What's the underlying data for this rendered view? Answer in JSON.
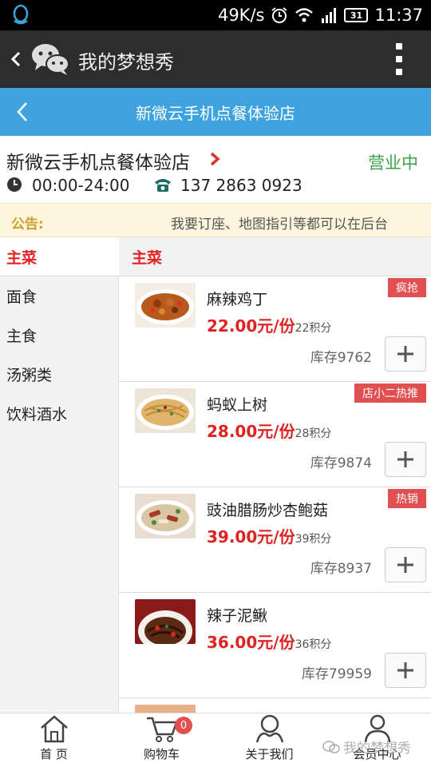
{
  "status_bar": {
    "speed": "49K/s",
    "battery": "31",
    "time": "11:37"
  },
  "wechat_header": {
    "title": "我的梦想秀"
  },
  "store_bar": {
    "title": "新微云手机点餐体验店"
  },
  "store": {
    "name": "新微云手机点餐体验店",
    "status": "营业中",
    "hours": "00:00-24:00",
    "phone": "137 2863 0923"
  },
  "notice": {
    "label": "公告:",
    "text": "我要订座、地图指引等都可以在后台"
  },
  "categories": [
    {
      "label": "主菜",
      "active": true
    },
    {
      "label": "面食"
    },
    {
      "label": "主食"
    },
    {
      "label": "汤粥类"
    },
    {
      "label": "饮料酒水"
    }
  ],
  "section_title": "主菜",
  "items": [
    {
      "name": "麻辣鸡丁",
      "price": "22.00元/份",
      "points": "22积分",
      "stock": "库存9762",
      "badge": "疯抢"
    },
    {
      "name": "蚂蚁上树",
      "price": "28.00元/份",
      "points": "28积分",
      "stock": "库存9874",
      "badge": "店小二热推"
    },
    {
      "name": "豉油腊肠炒杏鲍菇",
      "price": "39.00元/份",
      "points": "39积分",
      "stock": "库存8937",
      "badge": "热销"
    },
    {
      "name": "辣子泥鳅",
      "price": "36.00元/份",
      "points": "36积分",
      "stock": "库存79959",
      "badge": ""
    }
  ],
  "bottom_nav": {
    "home": "首 页",
    "cart": "购物车",
    "cart_count": "0",
    "about": "关于我们",
    "member": "会员中心"
  },
  "watermark": "我的梦想秀",
  "colors": {
    "accent_blue": "#3fa3e0",
    "price_red": "#e02222",
    "badge_red": "#e05050",
    "open_green": "#3ea04a"
  }
}
